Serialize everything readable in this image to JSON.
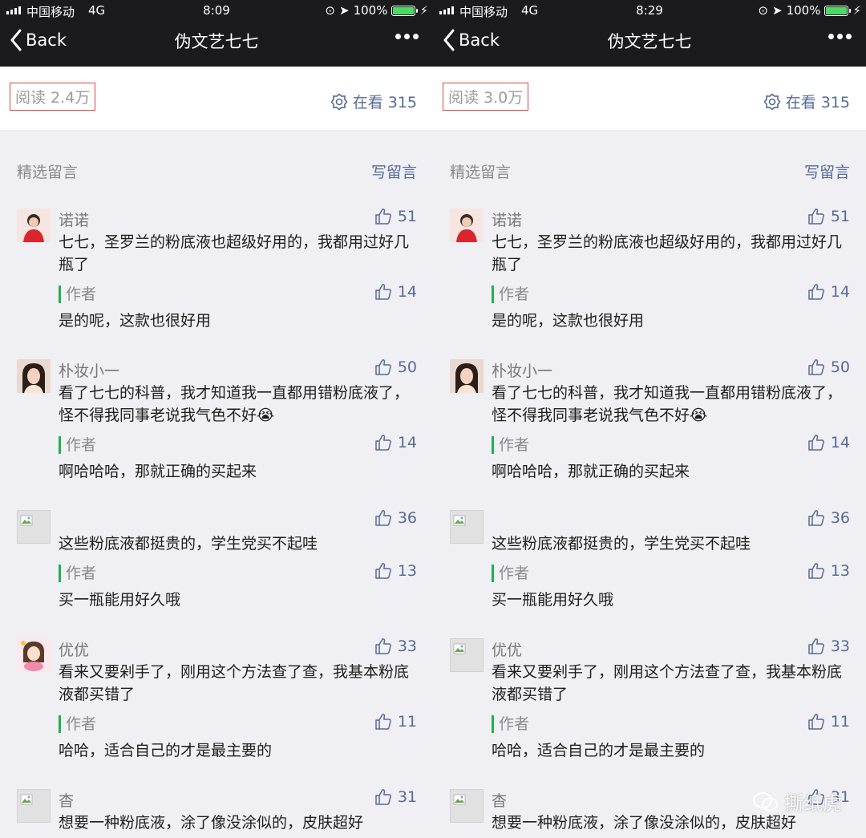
{
  "left": {
    "status": {
      "carrier": "中国移动",
      "network": "4G",
      "time": "8:09",
      "battery": "100%"
    },
    "nav": {
      "back_label": "Back",
      "title": "伪文艺七七"
    },
    "stats": {
      "reads": "阅读 2.4万",
      "watching": "在看 315"
    },
    "section": {
      "title": "精选留言",
      "write_label": "写留言"
    },
    "comments": [
      {
        "name": "诺诺",
        "likes": "51",
        "text": "七七，圣罗兰的粉底液也超级好用的，我都用过好几瓶了",
        "author_label": "作者",
        "reply_likes": "14",
        "reply": "是的呢，这款也很好用"
      },
      {
        "name": "朴妆小一",
        "likes": "50",
        "text": "看了七七的科普，我才知道我一直都用错粉底液了，怪不得我同事老说我气色不好😭",
        "author_label": "作者",
        "reply_likes": "14",
        "reply": "啊哈哈哈，那就正确的买起来"
      },
      {
        "name": "",
        "likes": "36",
        "text": "这些粉底液都挺贵的，学生党买不起哇",
        "author_label": "作者",
        "reply_likes": "13",
        "reply": "买一瓶能用好久哦"
      },
      {
        "name": "优优",
        "likes": "33",
        "text": "看来又要剁手了，刚用这个方法查了查，我基本粉底液都买错了",
        "author_label": "作者",
        "reply_likes": "11",
        "reply": "哈哈，适合自己的才是最主要的"
      },
      {
        "name": "杳",
        "likes": "31",
        "text": "想要一种粉底液，涂了像没涂似的，皮肤超好",
        "author_label": "",
        "reply_likes": "",
        "reply": ""
      }
    ]
  },
  "right": {
    "status": {
      "carrier": "中国移动",
      "network": "4G",
      "time": "8:29",
      "battery": "100%"
    },
    "nav": {
      "back_label": "Back",
      "title": "伪文艺七七"
    },
    "stats": {
      "reads": "阅读 3.0万",
      "watching": "在看 315"
    },
    "section": {
      "title": "精选留言",
      "write_label": "写留言"
    },
    "comments": [
      {
        "name": "诺诺",
        "likes": "51",
        "text": "七七，圣罗兰的粉底液也超级好用的，我都用过好几瓶了",
        "author_label": "作者",
        "reply_likes": "14",
        "reply": "是的呢，这款也很好用"
      },
      {
        "name": "朴妆小一",
        "likes": "50",
        "text": "看了七七的科普，我才知道我一直都用错粉底液了，怪不得我同事老说我气色不好😭",
        "author_label": "作者",
        "reply_likes": "14",
        "reply": "啊哈哈哈，那就正确的买起来"
      },
      {
        "name": "",
        "likes": "36",
        "text": "这些粉底液都挺贵的，学生党买不起哇",
        "author_label": "作者",
        "reply_likes": "13",
        "reply": "买一瓶能用好久哦"
      },
      {
        "name": "优优",
        "likes": "33",
        "text": "看来又要剁手了，刚用这个方法查了查，我基本粉底液都买错了",
        "author_label": "作者",
        "reply_likes": "11",
        "reply": "哈哈，适合自己的才是最主要的"
      },
      {
        "name": "杳",
        "likes": "31",
        "text": "想要一种粉底液，涂了像没涂似的，皮肤超好",
        "author_label": "",
        "reply_likes": "",
        "reply": ""
      }
    ]
  },
  "watermark": {
    "text": "撕纸虎",
    "icon": "wechat-icon"
  },
  "colors": {
    "link_blue": "#576b95",
    "author_green": "#22b14c",
    "highlight_red": "#dd4444",
    "nav_dark": "#1b1b1d"
  }
}
